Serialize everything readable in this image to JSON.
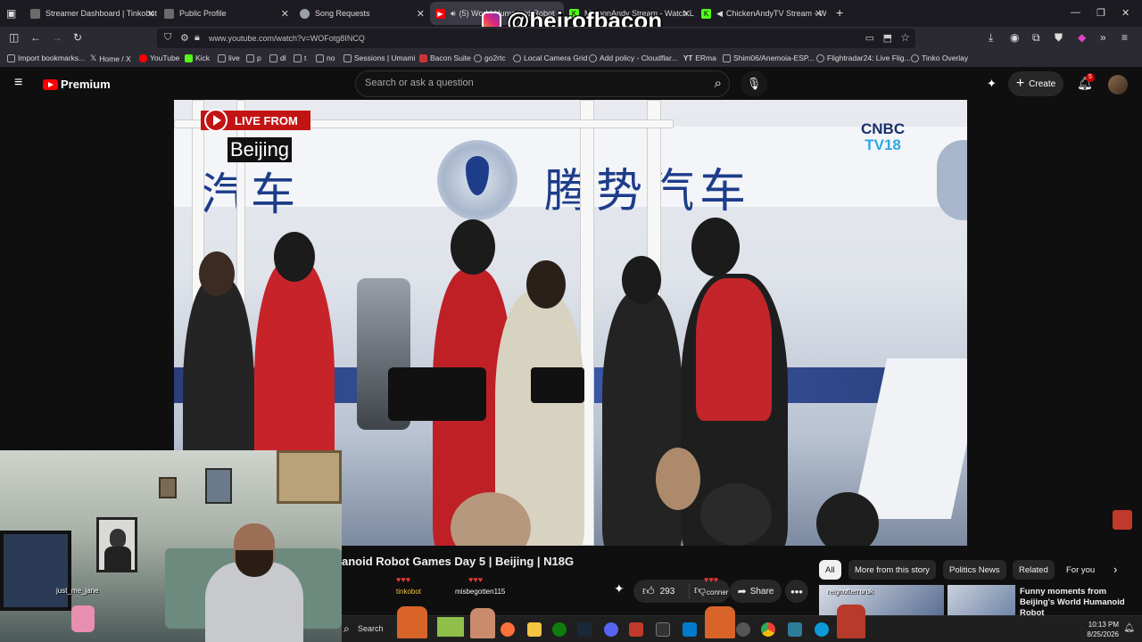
{
  "browser": {
    "tabs": [
      {
        "label": "Streamer Dashboard | Tinkobot",
        "favicon_color": "#6b6b6b"
      },
      {
        "label": "Public Profile",
        "favicon_color": "#6b6b6b"
      },
      {
        "label": "Song Requests",
        "favicon_color": "#9aa0a6"
      },
      {
        "label": "(5) World Humanoid Robot",
        "favicon_color": "#ff0000"
      },
      {
        "label": "MamonAndy Stream - Watch L",
        "favicon_color": "#53fc18"
      },
      {
        "label": "ChickenAndyTV Stream - W",
        "favicon_color": "#53fc18"
      }
    ],
    "new_tab_label": "+",
    "url": "www.youtube.com/watch?v=WOFotg8INCQ",
    "bookmarks": [
      "Import bookmarks...",
      "Home / X",
      "YouTube",
      "Kick",
      "live",
      "p",
      "dl",
      "t",
      "no",
      "Sessions | Umami",
      "Bacon Suite",
      "go2rtc",
      "Local Camera Grid",
      "Add policy - Cloudflar...",
      "ERma",
      "Shim06/Anemoia-ESP...",
      "Flightradar24: Live Flig...",
      "Tinko Overlay"
    ]
  },
  "youtube": {
    "logo_text": "Premium",
    "search_placeholder": "Search or ask a question",
    "create_label": "Create",
    "notification_count": "5"
  },
  "video": {
    "live_label": "LIVE FROM",
    "location": "Beijing",
    "network_line1": "CNBC",
    "network_line2": "TV18",
    "banner_text": "腾势汽车",
    "banner_text_left": "汽车",
    "title": "anoid Robot Games Day 5 | Beijing | N18G",
    "likes": "293",
    "share_label": "Share"
  },
  "overlay": {
    "handle": "@heirofbacon",
    "chat_users": [
      "just_me_jane",
      "tinkobot",
      "misbegotten115",
      "conner",
      "reignofterroruk"
    ]
  },
  "filters": [
    "All",
    "More from this story",
    "Politics News",
    "Related",
    "For you"
  ],
  "related": {
    "title": "Funny moments from Beijing's World Humanoid Robot"
  },
  "taskbar": {
    "search_label": "Search",
    "time": "10:13 PM",
    "date": "8/25/2026"
  }
}
